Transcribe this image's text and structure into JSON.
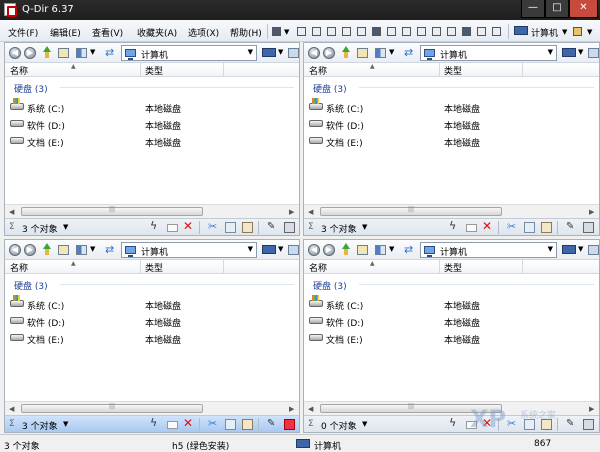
{
  "window": {
    "title": "Q-Dir 6.37",
    "minimize": "—",
    "maximize": "□",
    "close": "✕"
  },
  "menu": {
    "items": [
      "文件(F)",
      "编辑(E)",
      "查看(V)",
      "收藏夹(A)",
      "选项(X)",
      "帮助(H)"
    ],
    "location": "计算机"
  },
  "panes": [
    {
      "address": "计算机",
      "col_name": "名称",
      "col_type": "类型",
      "group": "硬盘 (3)",
      "rows": [
        {
          "name": "系统 (C:)",
          "type": "本地磁盘"
        },
        {
          "name": "软件 (D:)",
          "type": "本地磁盘"
        },
        {
          "name": "文档 (E:)",
          "type": "本地磁盘"
        }
      ],
      "status": "3 个对象"
    },
    {
      "address": "计算机",
      "col_name": "名称",
      "col_type": "类型",
      "group": "硬盘 (3)",
      "rows": [
        {
          "name": "系统 (C:)",
          "type": "本地磁盘"
        },
        {
          "name": "软件 (D:)",
          "type": "本地磁盘"
        },
        {
          "name": "文档 (E:)",
          "type": "本地磁盘"
        }
      ],
      "status": "3 个对象"
    },
    {
      "address": "计算机",
      "col_name": "名称",
      "col_type": "类型",
      "group": "硬盘 (3)",
      "rows": [
        {
          "name": "系统 (C:)",
          "type": "本地磁盘"
        },
        {
          "name": "软件 (D:)",
          "type": "本地磁盘"
        },
        {
          "name": "文档 (E:)",
          "type": "本地磁盘"
        }
      ],
      "status": "3 个对象"
    },
    {
      "address": "计算机",
      "col_name": "名称",
      "col_type": "类型",
      "group": "硬盘 (3)",
      "rows": [
        {
          "name": "系统 (C:)",
          "type": "本地磁盘"
        },
        {
          "name": "软件 (D:)",
          "type": "本地磁盘"
        },
        {
          "name": "文档 (E:)",
          "type": "本地磁盘"
        }
      ],
      "status": "0 个对象"
    }
  ],
  "global_status": {
    "count": "3 个对象",
    "selection": "h5 (绿色安装)",
    "location": "计算机",
    "number": "867"
  },
  "watermark": {
    "text": "XP",
    "sub": "系统之家"
  },
  "icons": {
    "lightning": "ϟ",
    "delete": "✕",
    "scissors": "✂",
    "edit": "✎",
    "back": "◀",
    "forward": "▶",
    "refresh": "⇄",
    "dropdown": "▼",
    "sort": "▲"
  }
}
